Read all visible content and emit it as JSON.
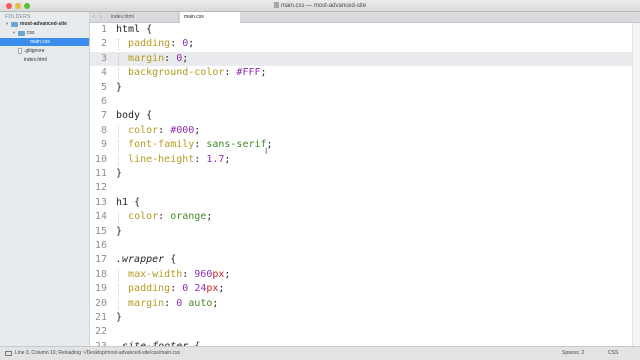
{
  "window": {
    "title": "main.css — most-advanced-site",
    "traffic_lights": [
      "close",
      "minimize",
      "maximize"
    ]
  },
  "sidebar": {
    "header": "FOLDERS",
    "root": "most-advanced-site",
    "css_folder": "css",
    "main_css": "main.css",
    "gitignore": ".gitignore",
    "index_html": "index.html"
  },
  "tabs": {
    "back_icon": "‹",
    "forward_icon": "›",
    "items": [
      {
        "label": "index.html",
        "active": false
      },
      {
        "label": "main.css",
        "active": true
      }
    ]
  },
  "editor": {
    "current_line": 3,
    "lines": [
      {
        "num": "1",
        "tokens": [
          {
            "t": "html",
            "c": "t-sel"
          },
          {
            "t": " {",
            "c": "t-punc"
          }
        ]
      },
      {
        "num": "2",
        "tokens": [
          {
            "t": "  ",
            "c": "t-punc"
          },
          {
            "t": "padding",
            "c": "t-prop"
          },
          {
            "t": ": ",
            "c": "t-punc"
          },
          {
            "t": "0",
            "c": "t-num"
          },
          {
            "t": ";",
            "c": "t-punc"
          }
        ]
      },
      {
        "num": "3",
        "tokens": [
          {
            "t": "  ",
            "c": "t-punc"
          },
          {
            "t": "margin",
            "c": "t-prop"
          },
          {
            "t": ": ",
            "c": "t-punc"
          },
          {
            "t": "0",
            "c": "t-num"
          },
          {
            "t": ";",
            "c": "t-punc"
          }
        ]
      },
      {
        "num": "4",
        "tokens": [
          {
            "t": "  ",
            "c": "t-punc"
          },
          {
            "t": "background-color",
            "c": "t-prop"
          },
          {
            "t": ": ",
            "c": "t-punc"
          },
          {
            "t": "#FFF",
            "c": "t-num"
          },
          {
            "t": ";",
            "c": "t-punc"
          }
        ]
      },
      {
        "num": "5",
        "tokens": [
          {
            "t": "}",
            "c": "t-punc"
          }
        ]
      },
      {
        "num": "6",
        "tokens": []
      },
      {
        "num": "7",
        "tokens": [
          {
            "t": "body",
            "c": "t-sel"
          },
          {
            "t": " {",
            "c": "t-punc"
          }
        ]
      },
      {
        "num": "8",
        "tokens": [
          {
            "t": "  ",
            "c": "t-punc"
          },
          {
            "t": "color",
            "c": "t-prop"
          },
          {
            "t": ": ",
            "c": "t-punc"
          },
          {
            "t": "#000",
            "c": "t-num"
          },
          {
            "t": ";",
            "c": "t-punc"
          }
        ]
      },
      {
        "num": "9",
        "tokens": [
          {
            "t": "  ",
            "c": "t-punc"
          },
          {
            "t": "font-family",
            "c": "t-prop"
          },
          {
            "t": ": ",
            "c": "t-punc"
          },
          {
            "t": "sans-serif",
            "c": "t-str"
          },
          {
            "t": ";",
            "c": "t-punc"
          }
        ]
      },
      {
        "num": "10",
        "tokens": [
          {
            "t": "  ",
            "c": "t-punc"
          },
          {
            "t": "line-height",
            "c": "t-prop"
          },
          {
            "t": ": ",
            "c": "t-punc"
          },
          {
            "t": "1.7",
            "c": "t-num"
          },
          {
            "t": ";",
            "c": "t-punc"
          }
        ]
      },
      {
        "num": "11",
        "tokens": [
          {
            "t": "}",
            "c": "t-punc"
          }
        ]
      },
      {
        "num": "12",
        "tokens": []
      },
      {
        "num": "13",
        "tokens": [
          {
            "t": "h1",
            "c": "t-sel"
          },
          {
            "t": " {",
            "c": "t-punc"
          }
        ]
      },
      {
        "num": "14",
        "tokens": [
          {
            "t": "  ",
            "c": "t-punc"
          },
          {
            "t": "color",
            "c": "t-prop"
          },
          {
            "t": ": ",
            "c": "t-punc"
          },
          {
            "t": "orange",
            "c": "t-str"
          },
          {
            "t": ";",
            "c": "t-punc"
          }
        ]
      },
      {
        "num": "15",
        "tokens": [
          {
            "t": "}",
            "c": "t-punc"
          }
        ]
      },
      {
        "num": "16",
        "tokens": []
      },
      {
        "num": "17",
        "tokens": [
          {
            "t": ".wrapper",
            "c": "t-sel-italic"
          },
          {
            "t": " {",
            "c": "t-punc"
          }
        ]
      },
      {
        "num": "18",
        "tokens": [
          {
            "t": "  ",
            "c": "t-punc"
          },
          {
            "t": "max-width",
            "c": "t-prop"
          },
          {
            "t": ": ",
            "c": "t-punc"
          },
          {
            "t": "960",
            "c": "t-num"
          },
          {
            "t": "px",
            "c": "t-unit"
          },
          {
            "t": ";",
            "c": "t-punc"
          }
        ]
      },
      {
        "num": "19",
        "tokens": [
          {
            "t": "  ",
            "c": "t-punc"
          },
          {
            "t": "padding",
            "c": "t-prop"
          },
          {
            "t": ": ",
            "c": "t-punc"
          },
          {
            "t": "0",
            "c": "t-num"
          },
          {
            "t": " ",
            "c": "t-punc"
          },
          {
            "t": "24",
            "c": "t-num"
          },
          {
            "t": "px",
            "c": "t-unit"
          },
          {
            "t": ";",
            "c": "t-punc"
          }
        ]
      },
      {
        "num": "20",
        "tokens": [
          {
            "t": "  ",
            "c": "t-punc"
          },
          {
            "t": "margin",
            "c": "t-prop"
          },
          {
            "t": ": ",
            "c": "t-punc"
          },
          {
            "t": "0",
            "c": "t-num"
          },
          {
            "t": " ",
            "c": "t-punc"
          },
          {
            "t": "auto",
            "c": "t-str"
          },
          {
            "t": ";",
            "c": "t-punc"
          }
        ]
      },
      {
        "num": "21",
        "tokens": [
          {
            "t": "}",
            "c": "t-punc"
          }
        ]
      },
      {
        "num": "22",
        "tokens": []
      },
      {
        "num": "23",
        "tokens": [
          {
            "t": ".site-footer",
            "c": "t-sel-italic"
          },
          {
            "t": " {",
            "c": "t-punc"
          }
        ]
      }
    ]
  },
  "status": {
    "text": "Line 3, Column 10; Reloading ~/Desktop/most-advanced-site/css/main.css",
    "spaces": "Spaces: 2",
    "syntax": "CSS"
  },
  "colors": {
    "selector": "#252525",
    "property": "#b59b1f",
    "number": "#8f2fb4",
    "string": "#468a2c",
    "unit": "#cc2525",
    "current_line_bg": "#e9ebee",
    "sidebar_selection": "#3b8ded"
  }
}
